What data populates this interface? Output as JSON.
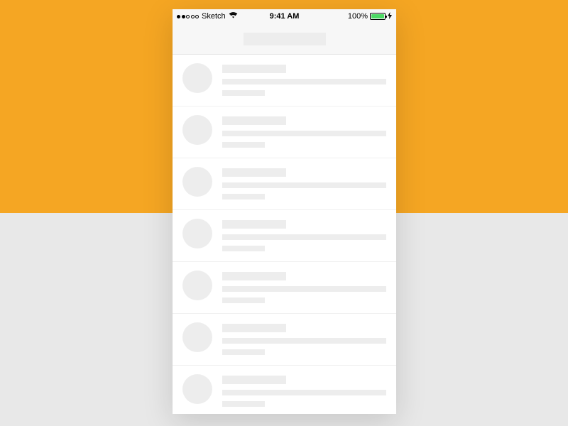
{
  "statusBar": {
    "carrier": "Sketch",
    "time": "9:41 AM",
    "batteryPercent": "100%"
  },
  "colors": {
    "bgTop": "#F5A623",
    "bgBottom": "#E8E8E8",
    "placeholder": "#EDEDED",
    "batteryFill": "#4CD964"
  },
  "listItems": [
    {},
    {},
    {},
    {},
    {},
    {},
    {}
  ]
}
